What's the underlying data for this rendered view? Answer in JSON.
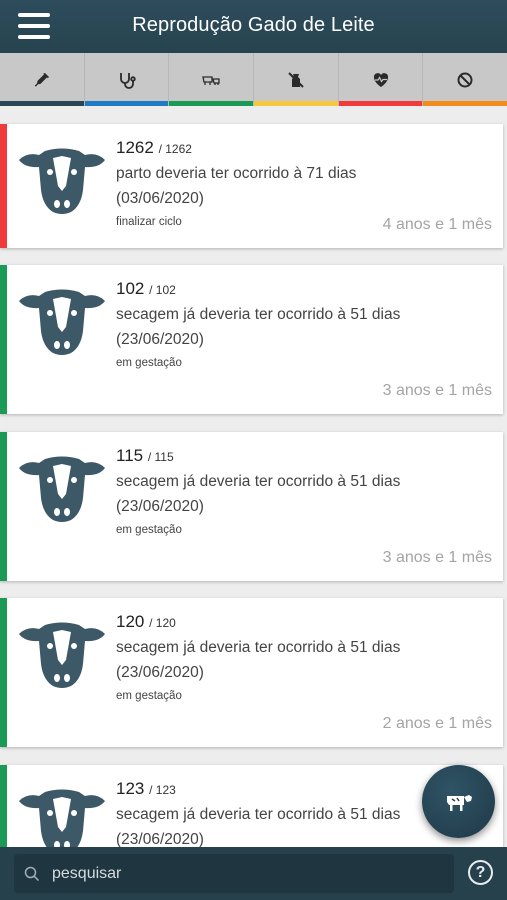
{
  "header": {
    "title": "Reprodução Gado de Leite",
    "menu_icon": "hamburger-menu-icon"
  },
  "tabs": [
    {
      "icon": "syringe-icon",
      "color": "#2a4653"
    },
    {
      "icon": "stethoscope-icon",
      "color": "#1e7bc4"
    },
    {
      "icon": "cow-family-icon",
      "color": "#1a9a55"
    },
    {
      "icon": "no-milk-icon",
      "color": "#f5c842"
    },
    {
      "icon": "heartbeat-icon",
      "color": "#ef3b3b"
    },
    {
      "icon": "cancel-icon",
      "color": "#f28c1e"
    }
  ],
  "animals": [
    {
      "id": "1262",
      "sub_id": "/ 1262",
      "description": "parto deveria ter ocorrido à 71 dias (03/06/2020)",
      "status": "finalizar ciclo",
      "age": "4 anos e 1 mês",
      "accent": "#ef3b3b"
    },
    {
      "id": "102",
      "sub_id": "/ 102",
      "description": "secagem já deveria ter ocorrido à 51 dias (23/06/2020)",
      "status": "em gestação",
      "age": "3 anos e 1 mês",
      "accent": "#1a9a55"
    },
    {
      "id": "115",
      "sub_id": "/ 115",
      "description": "secagem já deveria ter ocorrido à 51 dias (23/06/2020)",
      "status": "em gestação",
      "age": "3 anos e 1 mês",
      "accent": "#1a9a55"
    },
    {
      "id": "120",
      "sub_id": "/ 120",
      "description": "secagem já deveria ter ocorrido à 51 dias (23/06/2020)",
      "status": "em gestação",
      "age": "2 anos e 1 mês",
      "accent": "#1a9a55"
    },
    {
      "id": "123",
      "sub_id": "/ 123",
      "description": "secagem já deveria ter ocorrido à 51 dias (23/06/2020)",
      "status": "",
      "age": "",
      "accent": "#1a9a55"
    }
  ],
  "fab": {
    "icon": "add-cow-icon"
  },
  "search": {
    "placeholder": "pesquisar",
    "value": ""
  },
  "help": {
    "label": "?"
  }
}
